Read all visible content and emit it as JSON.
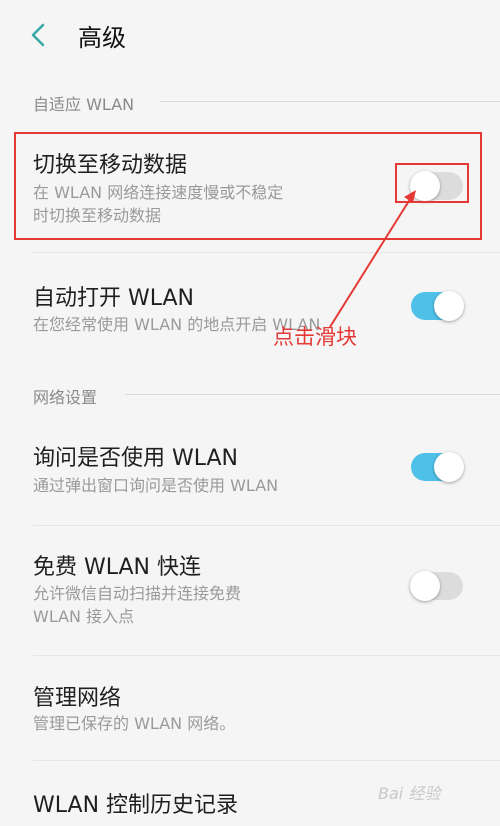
{
  "header": {
    "title": "高级",
    "back_icon": "chevron-left-icon"
  },
  "sections": {
    "adaptive": "自适应 WLAN",
    "network": "网络设置"
  },
  "rows": {
    "switch_mobile": {
      "title": "切换至移动数据",
      "desc_line1": "在 WLAN 网络连接速度慢或不稳定",
      "desc_line2": "时切换至移动数据",
      "toggle_on": false
    },
    "auto_open": {
      "title": "自动打开 WLAN",
      "desc": "在您经常使用 WLAN 的地点开启 WLAN",
      "toggle_on": true
    },
    "ask_use": {
      "title": "询问是否使用 WLAN",
      "desc": "通过弹出窗口询问是否使用 WLAN",
      "toggle_on": true
    },
    "free_wlan": {
      "title": "免费 WLAN 快连",
      "desc_line1": "允许微信自动扫描并连接免费",
      "desc_line2": "WLAN 接入点",
      "toggle_on": false
    },
    "manage": {
      "title": "管理网络",
      "desc": "管理已保存的 WLAN 网络。"
    },
    "history": {
      "title": "WLAN 控制历史记录"
    }
  },
  "annotation": {
    "text": "点击滑块",
    "color": "#e53935"
  },
  "watermark": "Bai 经验",
  "colors": {
    "toggle_on": "#4fc1e9",
    "toggle_off": "#dcdcdc",
    "highlight": "#e53935"
  }
}
